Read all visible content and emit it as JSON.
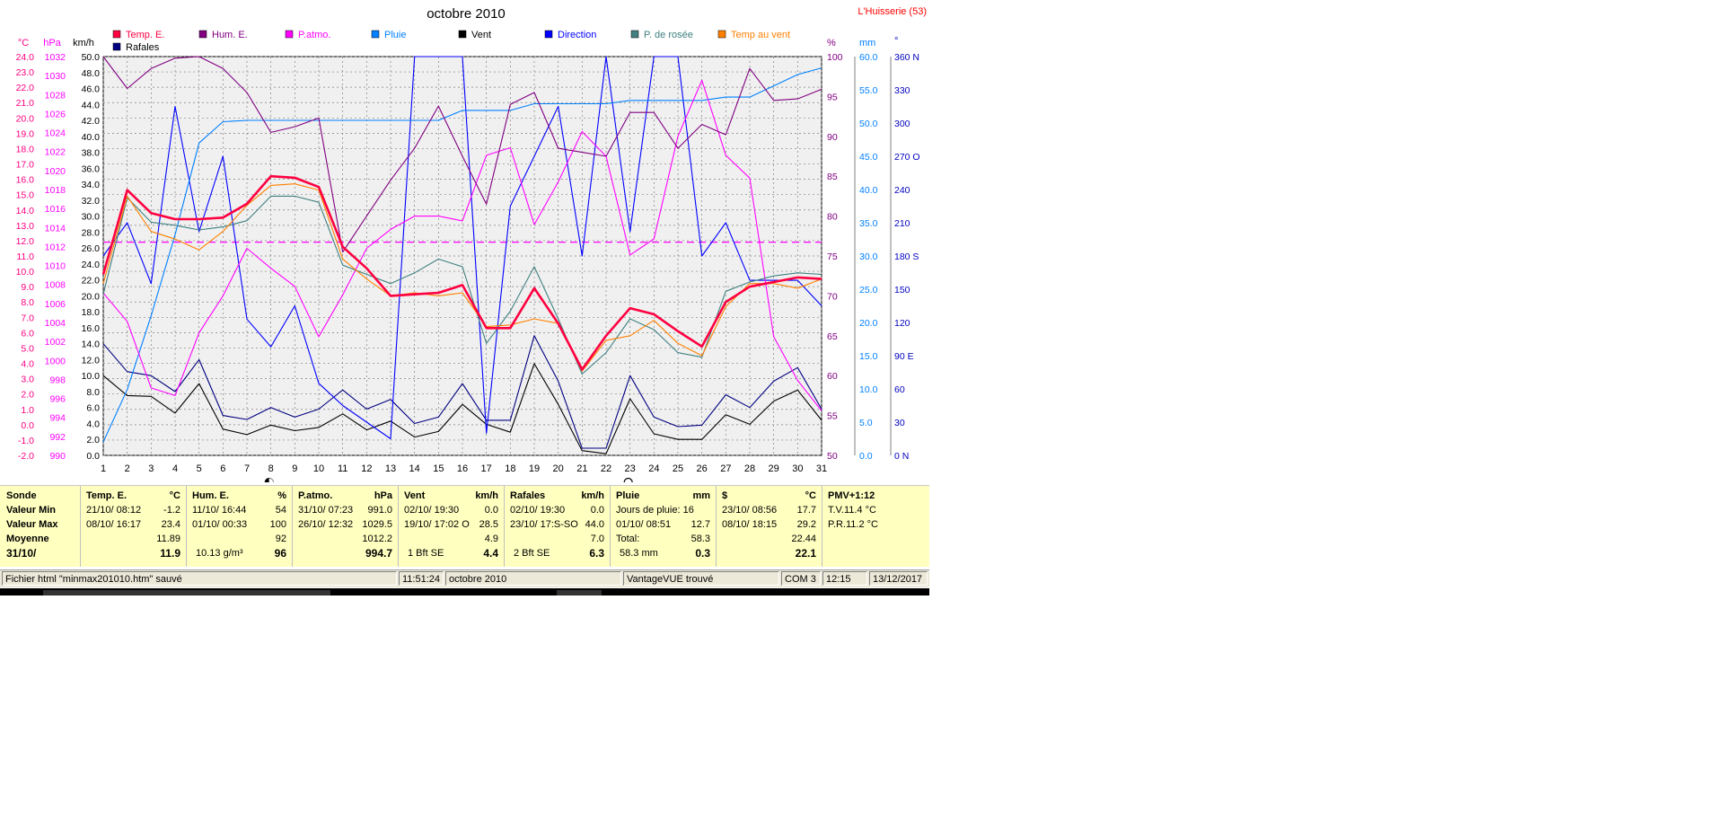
{
  "station": "L'Huisserie (53)",
  "chart_data": {
    "type": "line",
    "title": "octobre 2010",
    "x": [
      1,
      2,
      3,
      4,
      5,
      6,
      7,
      8,
      9,
      10,
      11,
      12,
      13,
      14,
      15,
      16,
      17,
      18,
      19,
      20,
      21,
      22,
      23,
      24,
      25,
      26,
      27,
      28,
      29,
      30,
      31
    ],
    "xlim": [
      1,
      31
    ],
    "grid": true,
    "legend_placement": "top",
    "axes": {
      "temp_c": {
        "unit": "°C",
        "range": [
          -2,
          24
        ],
        "ticks": [
          -2,
          -1,
          0,
          1,
          2,
          3,
          4,
          5,
          6,
          7,
          8,
          9,
          10,
          11,
          12,
          13,
          14,
          15,
          16,
          17,
          18,
          19,
          20,
          21,
          22,
          23,
          24
        ]
      },
      "pressure_hpa": {
        "unit": "hPa",
        "range": [
          990,
          1032
        ],
        "ticks": [
          990,
          992,
          994,
          996,
          998,
          1000,
          1002,
          1004,
          1006,
          1008,
          1010,
          1012,
          1014,
          1016,
          1018,
          1020,
          1022,
          1024,
          1026,
          1028,
          1030,
          1032
        ]
      },
      "wind_kmh": {
        "unit": "km/h",
        "range": [
          0,
          50
        ],
        "ticks": [
          0,
          2,
          4,
          6,
          8,
          10,
          12,
          14,
          16,
          18,
          20,
          22,
          24,
          26,
          28,
          30,
          32,
          34,
          36,
          38,
          40,
          42,
          44,
          46,
          48,
          50
        ]
      },
      "humidity_pct": {
        "unit": "%",
        "range": [
          50,
          100
        ],
        "ticks": [
          50,
          55,
          60,
          65,
          70,
          75,
          80,
          85,
          90,
          95,
          100
        ]
      },
      "rain_mm": {
        "unit": "mm",
        "range": [
          0,
          60
        ],
        "ticks": [
          0,
          5,
          10,
          15,
          20,
          25,
          30,
          35,
          40,
          45,
          50,
          55,
          60
        ]
      },
      "direction_deg": {
        "unit": "°",
        "range": [
          0,
          360
        ],
        "ticks": [
          "0 N",
          "30",
          "60",
          "90 E",
          "120",
          "150",
          "180 S",
          "210",
          "240",
          "270 O",
          "300",
          "330",
          "360 N"
        ]
      }
    },
    "series": [
      {
        "name": "Temp. E.",
        "axis": "temp_c",
        "color": "#ff0040",
        "values": [
          9.8,
          15.3,
          13.8,
          13.4,
          13.4,
          13.5,
          14.4,
          16.2,
          16.1,
          15.5,
          11.6,
          10.2,
          8.4,
          8.5,
          8.6,
          9.1,
          6.3,
          6.3,
          8.9,
          6.6,
          3.6,
          5.8,
          7.6,
          7.2,
          6.1,
          5.1,
          8.0,
          9.0,
          9.3,
          9.6,
          9.5
        ]
      },
      {
        "name": "Hum. E.",
        "axis": "humidity_pct",
        "color": "#800080",
        "values": [
          100,
          96,
          98.5,
          99.8,
          100,
          98.5,
          95.5,
          90.5,
          91.2,
          92.3,
          75.5,
          80,
          84.5,
          88.5,
          93.8,
          87.5,
          81.5,
          94,
          95.5,
          88.5,
          88,
          87.5,
          93,
          93,
          88.5,
          91.5,
          90.2,
          98.5,
          94.5,
          94.7,
          95.9
        ]
      },
      {
        "name": "P.atmo.",
        "axis": "pressure_hpa",
        "color": "#ff00ff",
        "values": [
          1007.1,
          1004.1,
          997.1,
          996.3,
          1002.9,
          1006.8,
          1011.8,
          1009.7,
          1007.8,
          1002.5,
          1006.9,
          1011.8,
          1013.8,
          1015.2,
          1015.2,
          1014.7,
          1021.6,
          1022.4,
          1014.3,
          1018.8,
          1024.1,
          1021.5,
          1011.1,
          1012.8,
          1023.6,
          1029.5,
          1021.6,
          1019.2,
          1002.5,
          997.9,
          994.7
        ]
      },
      {
        "name": "Pluie",
        "axis": "rain_mm",
        "color": "#0080ff",
        "values": [
          2.0,
          9.9,
          21.0,
          33.2,
          47.0,
          50.2,
          50.4,
          50.4,
          50.4,
          50.4,
          50.4,
          50.4,
          50.4,
          50.4,
          50.4,
          51.9,
          51.9,
          51.9,
          52.9,
          52.9,
          52.9,
          52.9,
          53.4,
          53.4,
          53.4,
          53.4,
          53.9,
          53.9,
          55.6,
          57.3,
          58.3
        ]
      },
      {
        "name": "Vent",
        "axis": "wind_kmh",
        "color": "#000000",
        "values": [
          10.0,
          7.5,
          7.4,
          5.3,
          9.0,
          3.3,
          2.6,
          3.8,
          3.1,
          3.5,
          5.2,
          3.2,
          4.3,
          2.3,
          3.0,
          6.4,
          3.9,
          2.9,
          11.5,
          6.4,
          0.6,
          0.2,
          7.1,
          2.7,
          2.0,
          2.0,
          5.1,
          3.9,
          6.8,
          8.2,
          4.4
        ]
      },
      {
        "name": "Direction",
        "axis": "direction_deg",
        "color": "#0000ff",
        "values": [
          180,
          210,
          155,
          315,
          202,
          270,
          123,
          98,
          135,
          65,
          45,
          30,
          15,
          360,
          360,
          360,
          20,
          225,
          270,
          315,
          180,
          360,
          202,
          360,
          360,
          180,
          210,
          158,
          158,
          158,
          135
        ]
      },
      {
        "name": "P. de rosée",
        "axis": "temp_c",
        "color": "#408080",
        "values": [
          8.5,
          14.8,
          13.2,
          13.0,
          12.7,
          12.9,
          13.3,
          14.9,
          14.9,
          14.5,
          10.4,
          9.8,
          9.2,
          9.9,
          10.8,
          10.3,
          5.3,
          7.4,
          10.3,
          6.9,
          3.3,
          4.7,
          6.9,
          6.2,
          4.7,
          4.4,
          8.7,
          9.3,
          9.7,
          9.9,
          9.8
        ]
      },
      {
        "name": "Temp au vent",
        "axis": "temp_c",
        "color": "#ff8000",
        "values": [
          9.2,
          14.9,
          12.6,
          12.1,
          11.4,
          12.6,
          14.3,
          15.6,
          15.7,
          15.3,
          10.8,
          9.5,
          8.4,
          8.6,
          8.4,
          8.6,
          6.4,
          6.5,
          6.9,
          6.6,
          3.5,
          5.5,
          5.8,
          6.8,
          5.3,
          4.5,
          7.7,
          9.2,
          9.2,
          8.9,
          9.5
        ]
      },
      {
        "name": "Rafales",
        "axis": "wind_kmh",
        "color": "#000080",
        "values": [
          14.0,
          10.5,
          10.0,
          8.0,
          12.0,
          5.0,
          4.5,
          6.0,
          4.8,
          5.8,
          8.2,
          5.8,
          7.0,
          4.0,
          4.8,
          9.0,
          4.4,
          4.4,
          15.0,
          9.3,
          0.9,
          0.9,
          10.0,
          4.8,
          3.6,
          3.8,
          7.6,
          6.0,
          9.3,
          11.0,
          5.8
        ]
      }
    ],
    "reference_line": {
      "axis": "temp_c",
      "value": 11.9,
      "color": "#ff00ff",
      "style": "dashed"
    },
    "moon_phases": [
      {
        "day": 8,
        "phase": "new"
      },
      {
        "day": 23,
        "phase": "full"
      }
    ]
  },
  "legend": [
    {
      "label": "Temp. E.",
      "color": "#ff0040"
    },
    {
      "label": "Hum. E.",
      "color": "#800080"
    },
    {
      "label": "P.atmo.",
      "color": "#ff00ff"
    },
    {
      "label": "Pluie",
      "color": "#0080ff"
    },
    {
      "label": "Vent",
      "color": "#000000"
    },
    {
      "label": "Direction",
      "color": "#0000ff"
    },
    {
      "label": "P. de rosée",
      "color": "#408080"
    },
    {
      "label": "Temp au vent",
      "color": "#ff8000"
    },
    {
      "label": "Rafales",
      "color": "#000080"
    }
  ],
  "axis_units": {
    "temp": "°C",
    "pressure": "hPa",
    "wind": "km/h",
    "humidity": "%",
    "rain": "mm",
    "direction": "°"
  },
  "stats": {
    "rowlabels": {
      "header": "Sonde",
      "min": "Valeur Min",
      "max": "Valeur Max",
      "avg": "Moyenne",
      "current": "31/10/"
    },
    "temp": {
      "title": "Temp. E.",
      "unit": "°C",
      "min_date": "21/10/  08:12",
      "min_val": "-1.2",
      "max_date": "08/10/  16:17",
      "max_val": "23.4",
      "avg": "11.89",
      "current": "11.9"
    },
    "hum": {
      "title": "Hum. E.",
      "unit": "%",
      "min_date": "11/10/  16:44",
      "min_val": "54",
      "max_date": "01/10/  00:33",
      "max_val": "100",
      "avg": "92",
      "extra": "10.13 g/m³",
      "current": "96"
    },
    "press": {
      "title": "P.atmo.",
      "unit": "hPa",
      "min_date": "31/10/  07:23",
      "min_val": "991.0",
      "max_date": "26/10/  12:32",
      "max_val": "1029.5",
      "avg": "1012.2",
      "current": "994.7"
    },
    "wind": {
      "title": "Vent",
      "unit": "km/h",
      "min_date": "02/10/  19:30",
      "min_val": "0.0",
      "max_date": "19/10/  17:02  O",
      "max_val": "28.5",
      "avg": "4.9",
      "extra": "1 Bft SE",
      "current": "4.4"
    },
    "gust": {
      "title": "Rafales",
      "unit": "km/h",
      "min_date": "02/10/  19:30",
      "min_val": "0.0",
      "max_date": "23/10/  17:S-SO",
      "max_val": "44.0",
      "avg": "7.0",
      "extra": "2 Bft SE",
      "current": "6.3"
    },
    "rain": {
      "title": "Pluie",
      "unit": "mm",
      "line1": "Jours de pluie: 16",
      "max_date": "01/10/  08:51",
      "max_val": "12.7",
      "total_label": "Total:",
      "total": "58.3",
      "extra": "58.3 mm",
      "current": "0.3"
    },
    "dollar": {
      "title": "$",
      "unit": "°C",
      "min_date": "23/10/  08:56",
      "min_val": "17.7",
      "max_date": "08/10/  18:15",
      "max_val": "29.2",
      "avg": "22.44",
      "current": "22.1"
    },
    "pmv": {
      "title": "PMV+1:12",
      "line1": "T.V.11.4 °C",
      "line2": "P.R.11.2 °C"
    }
  },
  "statusbar": {
    "file": "Fichier html  \"minmax201010.htm\"  sauvé",
    "time": "11:51:24",
    "month": "octobre 2010",
    "device": "VantageVUE trouvé",
    "port": "COM 3",
    "clock": "12:15",
    "date": "13/12/2017"
  }
}
